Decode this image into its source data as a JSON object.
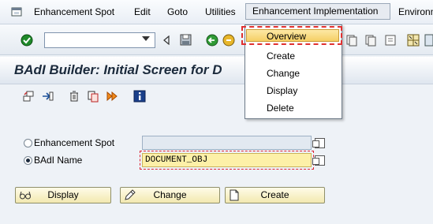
{
  "menubar": {
    "items": [
      "Enhancement Spot",
      "Edit",
      "Goto",
      "Utilities",
      "Enhancement Implementation",
      "Environm"
    ]
  },
  "toolbar": {
    "command_value": ""
  },
  "page": {
    "title": "BAdI Builder: Initial Screen for D"
  },
  "form": {
    "enh_spot_label": "Enhancement Spot",
    "enh_spot_value": "",
    "badi_name_label": "BAdI Name",
    "badi_name_value": "DOCUMENT_OBJ",
    "selected": "badi_name"
  },
  "buttons": {
    "display": "Display",
    "change": "Change",
    "create": "Create"
  },
  "dropdown": {
    "items": [
      "Overview",
      "Create",
      "Change",
      "Display",
      "Delete"
    ],
    "highlighted": "Overview"
  },
  "colors": {
    "accent_selected": "#f5cf65",
    "selection_border": "#e03030",
    "button_bg": "#f2e9b0",
    "active_field": "#fdf0a8"
  }
}
